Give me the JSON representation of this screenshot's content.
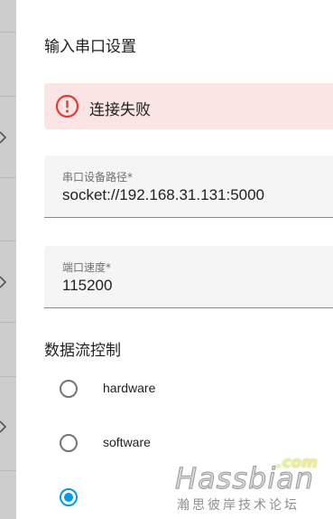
{
  "dialog": {
    "title": "输入串口设置",
    "alert": {
      "icon": "error-circle-icon",
      "text": "连接失败",
      "color": "#e53935"
    },
    "fields": [
      {
        "label": "串口设备路径*",
        "value": "socket://192.168.31.131:5000"
      },
      {
        "label": "端口速度*",
        "value": "115200"
      }
    ],
    "flow_control": {
      "title": "数据流控制",
      "options": [
        {
          "label": "hardware",
          "checked": false
        },
        {
          "label": "software",
          "checked": false
        },
        {
          "label": "",
          "checked": true
        }
      ]
    }
  },
  "watermark": {
    "brand": "Hassbian",
    "tld": ".com",
    "subtitle": "瀚思彼岸技术论坛"
  },
  "colors": {
    "accent": "#039be5",
    "error": "#e53935",
    "alert_bg": "#fbe4e4"
  }
}
